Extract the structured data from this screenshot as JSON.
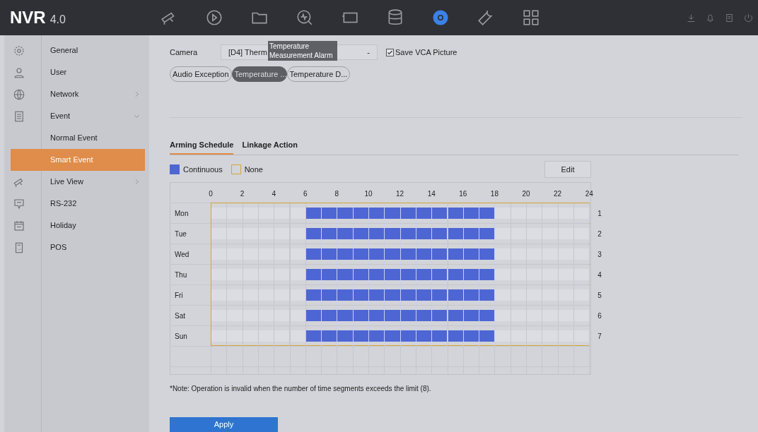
{
  "app": {
    "logo": "NVR",
    "version": "4.0"
  },
  "nav": [
    {
      "selected": false
    },
    {
      "selected": false
    },
    {
      "selected": false
    },
    {
      "selected": false
    },
    {
      "selected": false
    },
    {
      "selected": false
    },
    {
      "selected": true
    },
    {
      "selected": false
    },
    {
      "selected": false
    }
  ],
  "sidebar": {
    "items": [
      {
        "label": "General",
        "kind": "menu",
        "selected": false
      },
      {
        "label": "User",
        "kind": "menu",
        "selected": false
      },
      {
        "label": "Network",
        "kind": "group",
        "expanded": false,
        "selected": false
      },
      {
        "label": "Event",
        "kind": "group",
        "expanded": true,
        "selected": false
      },
      {
        "label": "Normal Event",
        "kind": "submenu",
        "selected": false
      },
      {
        "label": "Smart Event",
        "kind": "submenu",
        "selected": true
      },
      {
        "label": "Live View",
        "kind": "group",
        "expanded": false,
        "selected": false
      },
      {
        "label": "RS-232",
        "kind": "menu",
        "selected": false
      },
      {
        "label": "Holiday",
        "kind": "menu",
        "selected": false
      },
      {
        "label": "POS",
        "kind": "menu",
        "selected": false
      }
    ]
  },
  "camera": {
    "label": "Camera",
    "value": "[D4] Therm",
    "caret": "-",
    "save_vca": {
      "label": "Save VCA Picture",
      "checked": true
    }
  },
  "tooltip": "Temperature\nMeasurement Alarm",
  "event_tabs": [
    {
      "label": "Audio Exception",
      "selected": false
    },
    {
      "label": "Temperature ...",
      "selected": true
    },
    {
      "label": "Temperature D...",
      "selected": false
    }
  ],
  "sub_tabs": [
    {
      "label": "Arming Schedule",
      "selected": true
    },
    {
      "label": "Linkage Action",
      "selected": false
    }
  ],
  "legend": [
    {
      "label": "Continuous",
      "kind": "filled"
    },
    {
      "label": "None",
      "kind": "empty"
    }
  ],
  "edit_button": "Edit",
  "hour_ticks": [
    "0",
    "2",
    "4",
    "6",
    "8",
    "10",
    "12",
    "14",
    "16",
    "18",
    "20",
    "22",
    "24"
  ],
  "days": [
    {
      "label": "Mon",
      "number": "1",
      "hours": [
        false,
        false,
        false,
        false,
        false,
        false,
        true,
        true,
        true,
        true,
        true,
        true,
        true,
        true,
        true,
        true,
        true,
        true,
        false,
        false,
        false,
        false,
        false,
        false
      ]
    },
    {
      "label": "Tue",
      "number": "2",
      "hours": [
        false,
        false,
        false,
        false,
        false,
        false,
        true,
        true,
        true,
        true,
        true,
        true,
        true,
        true,
        true,
        true,
        true,
        true,
        false,
        false,
        false,
        false,
        false,
        false
      ]
    },
    {
      "label": "Wed",
      "number": "3",
      "hours": [
        false,
        false,
        false,
        false,
        false,
        false,
        true,
        true,
        true,
        true,
        true,
        true,
        true,
        true,
        true,
        true,
        true,
        true,
        false,
        false,
        false,
        false,
        false,
        false
      ]
    },
    {
      "label": "Thu",
      "number": "4",
      "hours": [
        false,
        false,
        false,
        false,
        false,
        false,
        true,
        true,
        true,
        true,
        true,
        true,
        true,
        true,
        true,
        true,
        true,
        true,
        false,
        false,
        false,
        false,
        false,
        false
      ]
    },
    {
      "label": "Fri",
      "number": "5",
      "hours": [
        false,
        false,
        false,
        false,
        false,
        false,
        true,
        true,
        true,
        true,
        true,
        true,
        true,
        true,
        true,
        true,
        true,
        true,
        false,
        false,
        false,
        false,
        false,
        false
      ]
    },
    {
      "label": "Sat",
      "number": "6",
      "hours": [
        false,
        false,
        false,
        false,
        false,
        false,
        true,
        true,
        true,
        true,
        true,
        true,
        true,
        true,
        true,
        true,
        true,
        true,
        false,
        false,
        false,
        false,
        false,
        false
      ]
    },
    {
      "label": "Sun",
      "number": "7",
      "hours": [
        false,
        false,
        false,
        false,
        false,
        false,
        true,
        true,
        true,
        true,
        true,
        true,
        true,
        true,
        true,
        true,
        true,
        true,
        false,
        false,
        false,
        false,
        false,
        false
      ]
    }
  ],
  "note": "*Note: Operation is invalid when the number of time segments exceeds the limit (8).",
  "apply_button": "Apply"
}
